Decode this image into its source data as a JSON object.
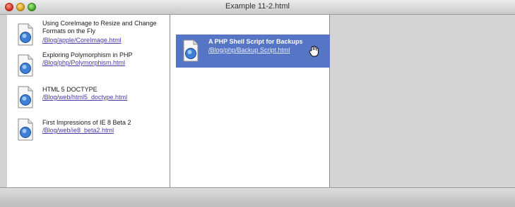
{
  "window": {
    "title": "Example 11-2.html"
  },
  "colors": {
    "selection": "#5675c5",
    "link": "#4a3aa9"
  },
  "pane1": {
    "items": [
      {
        "title": "Using CoreImage to Resize and Change Formats on the Fly",
        "link": "/Blog/apple/CoreImage.html",
        "icon": "html-document-icon"
      },
      {
        "title": "Exploring Polymorphism in PHP",
        "link": "/Blog/php/Polymorphism.html",
        "icon": "html-document-icon"
      },
      {
        "title": "HTML 5 DOCTYPE",
        "link": "/Blog/web/html5_doctype.html",
        "icon": "html-document-icon"
      },
      {
        "title": "First Impressions of IE 8 Beta 2",
        "link": "/Blog/web/ie8_beta2.html",
        "icon": "html-document-icon"
      }
    ]
  },
  "pane2": {
    "items": [
      {
        "title": "A PHP Shell Script for Backups",
        "link": "/Blog/php/Backup Script.html",
        "icon": "html-document-icon",
        "selected": true
      }
    ],
    "cursor": "hand-cursor-icon"
  }
}
